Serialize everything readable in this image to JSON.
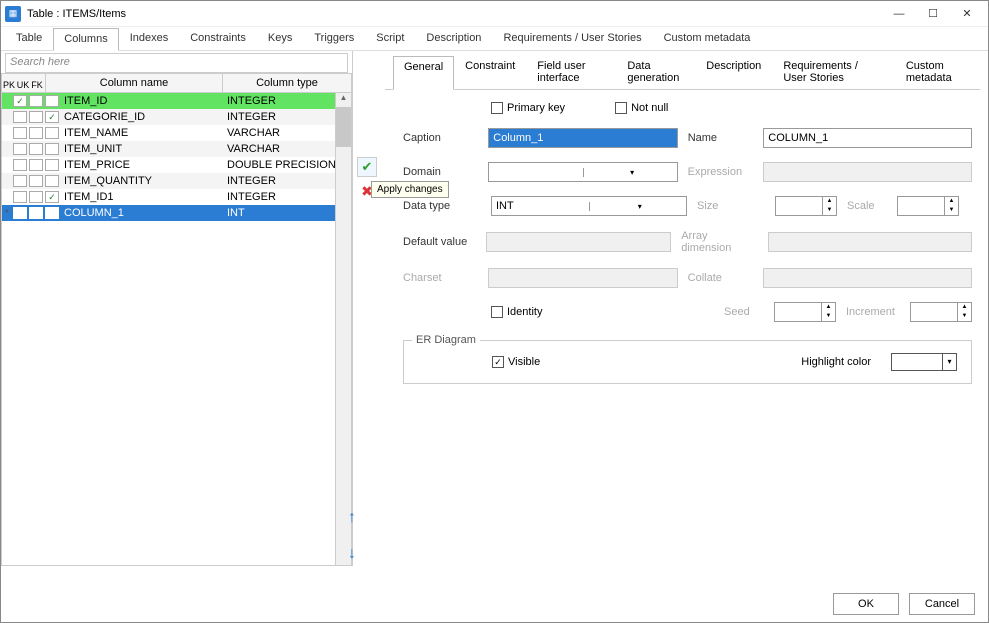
{
  "window": {
    "title": "Table : ITEMS/Items"
  },
  "main_tabs": [
    "Table",
    "Columns",
    "Indexes",
    "Constraints",
    "Keys",
    "Triggers",
    "Script",
    "Description",
    "Requirements / User Stories",
    "Custom metadata"
  ],
  "main_tab_active": 1,
  "search_placeholder": "Search here",
  "grid_headers": {
    "pk": "PK",
    "uk": "UK",
    "fk": "FK",
    "name": "Column name",
    "type": "Column type"
  },
  "columns": [
    {
      "marker": "",
      "pk": true,
      "uk": false,
      "fk": false,
      "name": "ITEM_ID",
      "type": "INTEGER",
      "green": true
    },
    {
      "marker": "",
      "pk": false,
      "uk": false,
      "fk": true,
      "name": "CATEGORIE_ID",
      "type": "INTEGER"
    },
    {
      "marker": "",
      "pk": false,
      "uk": false,
      "fk": false,
      "name": "ITEM_NAME",
      "type": "VARCHAR"
    },
    {
      "marker": "",
      "pk": false,
      "uk": false,
      "fk": false,
      "name": "ITEM_UNIT",
      "type": "VARCHAR"
    },
    {
      "marker": "",
      "pk": false,
      "uk": false,
      "fk": false,
      "name": "ITEM_PRICE",
      "type": "DOUBLE PRECISION"
    },
    {
      "marker": "",
      "pk": false,
      "uk": false,
      "fk": false,
      "name": "ITEM_QUANTITY",
      "type": "INTEGER"
    },
    {
      "marker": "",
      "pk": false,
      "uk": false,
      "fk": true,
      "name": "ITEM_ID1",
      "type": "INTEGER"
    },
    {
      "marker": "*",
      "pk": false,
      "uk": false,
      "fk": false,
      "name": "COLUMN_1",
      "type": "INT",
      "selected": true
    }
  ],
  "actions": {
    "apply_tooltip": "Apply changes"
  },
  "sub_tabs": [
    "General",
    "Constraint",
    "Field user interface",
    "Data generation",
    "Description",
    "Requirements / User Stories",
    "Custom metadata"
  ],
  "sub_tab_active": 0,
  "form": {
    "primary_key_label": "Primary key",
    "primary_key": false,
    "not_null_label": "Not null",
    "not_null": false,
    "caption_label": "Caption",
    "caption": "Column_1",
    "name_label": "Name",
    "name": "COLUMN_1",
    "domain_label": "Domain",
    "domain": "",
    "expression_label": "Expression",
    "expression": "",
    "data_type_label": "Data type",
    "data_type": "INT",
    "size_label": "Size",
    "size": "",
    "scale_label": "Scale",
    "scale": "",
    "default_label": "Default value",
    "default": "",
    "array_label": "Array dimension",
    "array": "",
    "charset_label": "Charset",
    "charset": "",
    "collate_label": "Collate",
    "collate": "",
    "identity_label": "Identity",
    "identity": false,
    "seed_label": "Seed",
    "seed": "",
    "increment_label": "Increment",
    "increment": "",
    "er_legend": "ER Diagram",
    "visible_label": "Visible",
    "visible": true,
    "highlight_label": "Highlight color",
    "highlight": "#ffffff"
  },
  "buttons": {
    "ok": "OK",
    "cancel": "Cancel"
  }
}
